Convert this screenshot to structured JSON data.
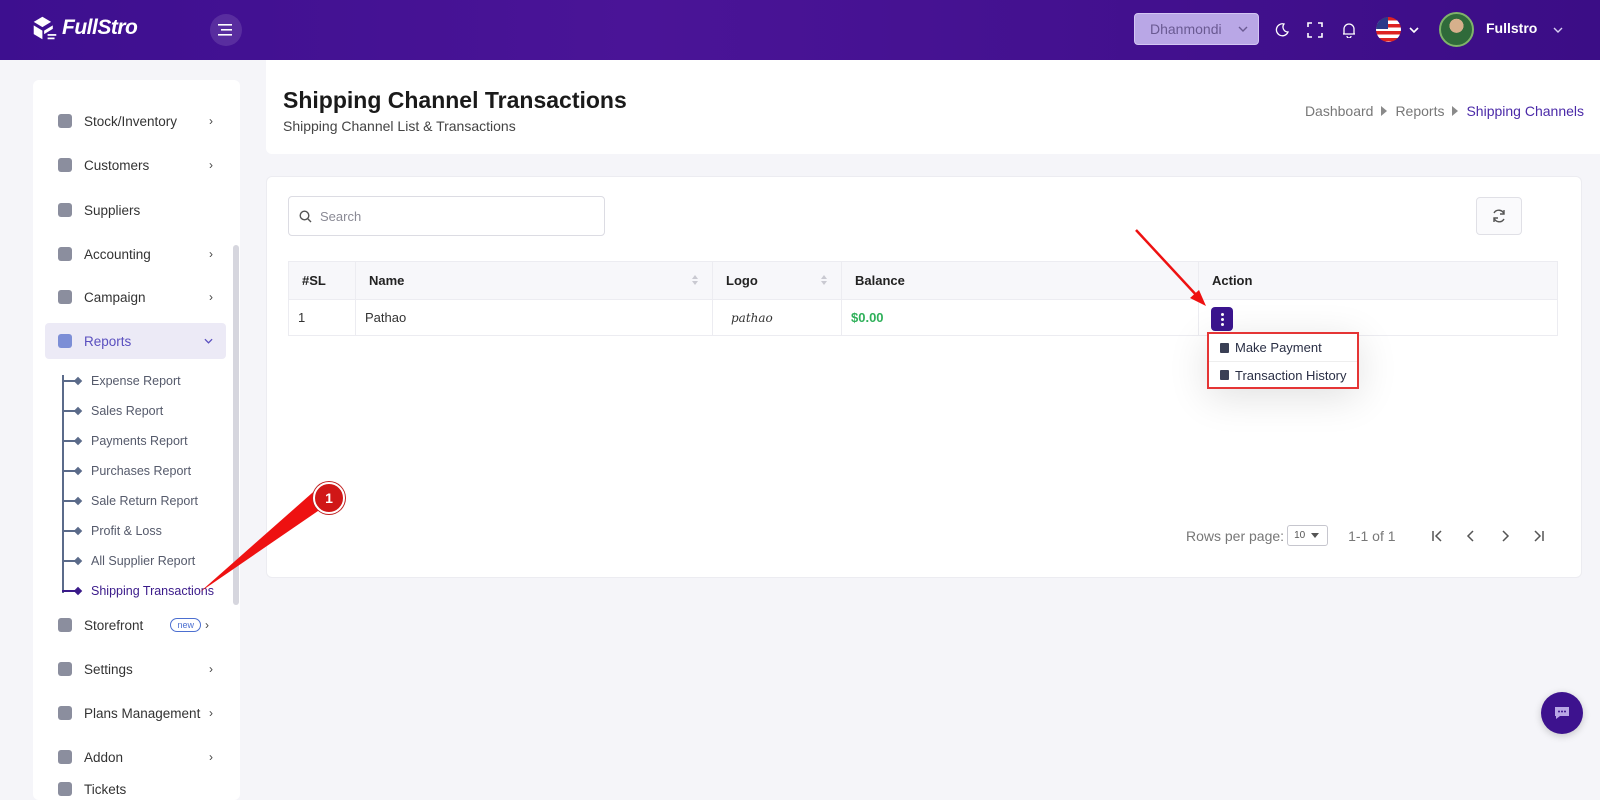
{
  "app": {
    "brand": "FullStro"
  },
  "topbar": {
    "branch_select": "Dhanmondi",
    "user_name": "Fullstro"
  },
  "sidebar": {
    "items": [
      {
        "label": "Stock/Inventory",
        "icon": "stock-icon",
        "has_chevron": true
      },
      {
        "label": "Customers",
        "icon": "customers-icon",
        "has_chevron": true
      },
      {
        "label": "Suppliers",
        "icon": "suppliers-icon",
        "has_chevron": false
      },
      {
        "label": "Accounting",
        "icon": "accounting-icon",
        "has_chevron": true
      },
      {
        "label": "Campaign",
        "icon": "campaign-icon",
        "has_chevron": true
      },
      {
        "label": "Reports",
        "icon": "reports-icon",
        "has_chevron": true,
        "active": true
      },
      {
        "label": "Storefront",
        "icon": "storefront-icon",
        "has_chevron": true,
        "badge": "new"
      },
      {
        "label": "Settings",
        "icon": "settings-icon",
        "has_chevron": true
      },
      {
        "label": "Plans Management",
        "icon": "plans-icon",
        "has_chevron": true
      },
      {
        "label": "Addon",
        "icon": "addon-icon",
        "has_chevron": true
      },
      {
        "label": "Tickets",
        "icon": "tickets-icon",
        "has_chevron": false
      }
    ],
    "report_subitems": [
      "Expense Report",
      "Sales Report",
      "Payments Report",
      "Purchases Report",
      "Sale Return Report",
      "Profit & Loss",
      "All Supplier Report",
      "Shipping Transactions"
    ]
  },
  "page": {
    "title": "Shipping Channel Transactions",
    "subtitle": "Shipping Channel List & Transactions",
    "breadcrumb": [
      "Dashboard",
      "Reports",
      "Shipping Channels"
    ]
  },
  "search": {
    "placeholder": "Search"
  },
  "table": {
    "columns": [
      "#SL",
      "Name",
      "Logo",
      "Balance",
      "Action"
    ],
    "rows": [
      {
        "sl": "1",
        "name": "Pathao",
        "logo": "pathao",
        "balance": "$0.00"
      }
    ]
  },
  "action_menu": {
    "items": [
      "Make Payment",
      "Transaction History"
    ]
  },
  "pagination": {
    "rows_per_page_label": "Rows per page:",
    "rows_per_page": "10",
    "range": "1-1 of 1"
  },
  "annotation": {
    "marker": "1"
  },
  "colors": {
    "brand": "#3d0f8f",
    "accent": "#3b158e",
    "balance": "#2fb05a",
    "highlight": "#e53535"
  }
}
